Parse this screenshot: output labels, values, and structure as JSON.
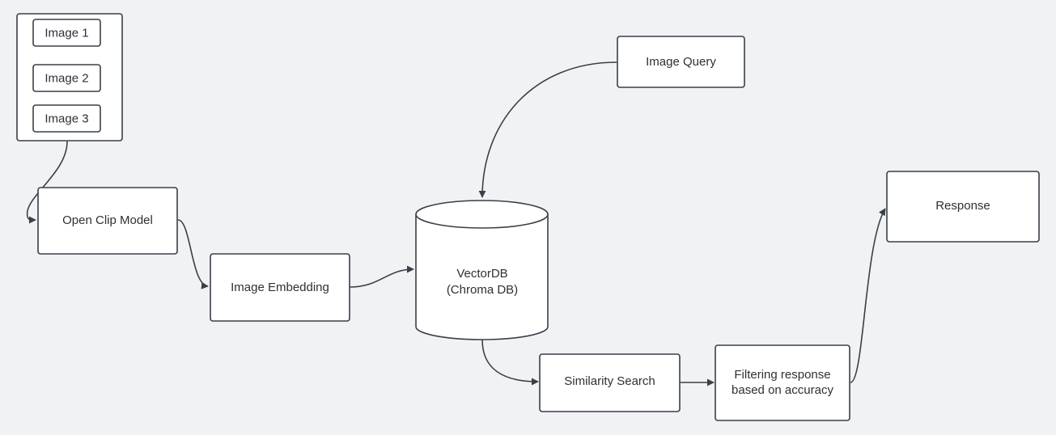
{
  "diagram": {
    "colors": {
      "background": "#f1f2f4",
      "stroke": "#3a3f48",
      "fill": "#ffffff",
      "text": "#2e3035"
    },
    "group": {
      "label": "image-set",
      "items": [
        "Image 1",
        "Image 2",
        "Image 3"
      ]
    },
    "nodes": {
      "open_clip": "Open Clip Model",
      "image_embedding": "Image Embedding",
      "vectordb": [
        "VectorDB",
        "(Chroma DB)"
      ],
      "image_query": "Image Query",
      "similarity_search": "Similarity Search",
      "filtering": [
        "Filtering response",
        "based on accuracy"
      ],
      "response": "Response"
    },
    "edges": [
      {
        "from": "image-set",
        "to": "open_clip"
      },
      {
        "from": "open_clip",
        "to": "image_embedding"
      },
      {
        "from": "image_embedding",
        "to": "vectordb"
      },
      {
        "from": "image_query",
        "to": "vectordb"
      },
      {
        "from": "vectordb",
        "to": "similarity_search"
      },
      {
        "from": "similarity_search",
        "to": "filtering"
      },
      {
        "from": "filtering",
        "to": "response"
      }
    ]
  }
}
